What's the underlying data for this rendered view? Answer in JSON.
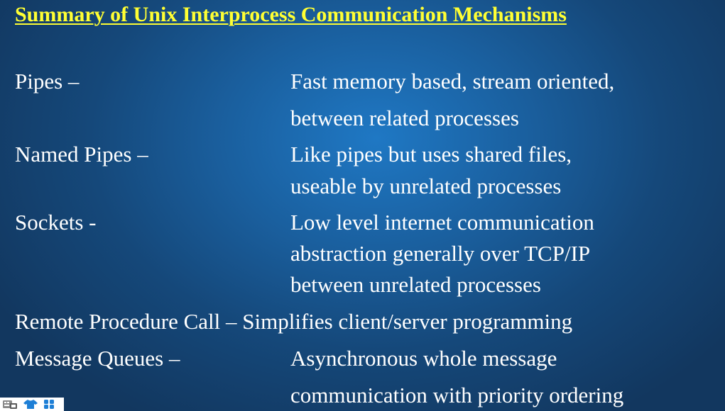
{
  "title": "Summary of Unix Interprocess Communication Mechanisms",
  "colors": {
    "title": "#ffff33",
    "text": "#ffffff",
    "background_center": "#1f78c4",
    "background_edge": "#12375f"
  },
  "mechanisms": [
    {
      "term": "Pipes –",
      "description": [
        "Fast memory based, stream oriented,",
        "between related processes"
      ]
    },
    {
      "term": "Named Pipes –",
      "description": [
        "Like pipes but uses shared files,",
        "useable by unrelated processes"
      ]
    },
    {
      "term": "Sockets  -",
      "description": [
        "Low level internet communication",
        "abstraction generally over TCP/IP",
        "between unrelated processes"
      ]
    },
    {
      "term": "Remote Procedure Call – Simplifies client/server programming",
      "description": []
    },
    {
      "term": "Message Queues –",
      "description": [
        "Asynchronous whole message",
        "communication with priority ordering"
      ]
    }
  ],
  "taskbar": {
    "icons": [
      "keyboard-language-icon",
      "shirt-icon",
      "apps-grid-icon"
    ]
  }
}
